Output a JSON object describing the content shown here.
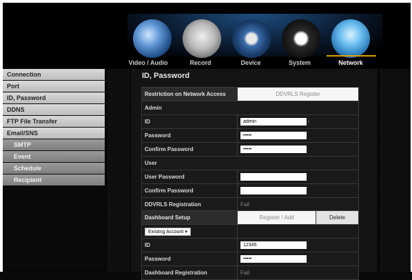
{
  "nav": [
    {
      "label": "Video / Audio",
      "icon": "film-reel-icon",
      "color": "#4a7fc0"
    },
    {
      "label": "Record",
      "icon": "hdd-icon",
      "color": "#a3a3a3"
    },
    {
      "label": "Device",
      "icon": "camera-lens-icon",
      "color": "#3a6aa8"
    },
    {
      "label": "System",
      "icon": "system-swirl-icon",
      "color": "#111111"
    },
    {
      "label": "Network",
      "icon": "network-icon",
      "color": "#4aa0d8"
    }
  ],
  "sidebar": [
    {
      "label": "Connection"
    },
    {
      "label": "Port"
    },
    {
      "label": "ID, Password"
    },
    {
      "label": "DDNS"
    },
    {
      "label": "FTP File Transfer"
    },
    {
      "label": "Email/SNS"
    },
    {
      "label": "SMTP"
    },
    {
      "label": "Event"
    },
    {
      "label": "Schedule"
    },
    {
      "label": "Recipient"
    }
  ],
  "page": {
    "title": "ID, Password"
  },
  "restrict": {
    "header": "Restriction on Network Access",
    "ddvrls_btn": "DDVRLS Register",
    "admin": "Admin",
    "id_label": "ID",
    "id_value": "admin",
    "id_suffix": "i",
    "password_label": "Password",
    "password_value": "•••••",
    "confirm_label": "Confirm Password",
    "confirm_value": "•••••",
    "user": "User",
    "user_password_label": "User Password",
    "user_confirm_label": "Confirm Password",
    "ddvrls_reg_label": "DDVRLS Registration",
    "ddvrls_reg_value": "Fail"
  },
  "dashboard": {
    "header": "Dashboard Setup",
    "register_btn": "Register / Add",
    "delete_btn": "Delete",
    "account_select": "Existing Account",
    "id_label": "ID",
    "id_value": "12345",
    "password_label": "Password",
    "password_value": "•••••",
    "reg_label": "Dashboard Registration",
    "reg_value": "Fail"
  }
}
